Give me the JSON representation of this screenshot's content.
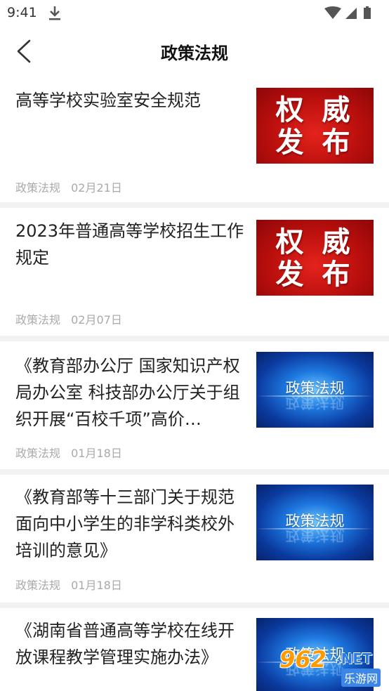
{
  "status_bar": {
    "time": "9:41"
  },
  "header": {
    "title": "政策法规"
  },
  "articles": [
    {
      "title": "高等学校实验室安全规范",
      "category": "政策法规",
      "date": "02月21日",
      "thumb_style": "red",
      "thumb_line1": "权 威",
      "thumb_line2": "发 布"
    },
    {
      "title": "2023年普通高等学校招生工作规定",
      "category": "政策法规",
      "date": "02月07日",
      "thumb_style": "red",
      "thumb_line1": "权 威",
      "thumb_line2": "发 布"
    },
    {
      "title": "《教育部办公厅 国家知识产权局办公室 科技部办公厅关于组织开展“百校千项”高价…",
      "category": "政策法规",
      "date": "01月18日",
      "thumb_style": "blue",
      "thumb_text": "政策法规"
    },
    {
      "title": "《教育部等十三部门关于规范面向中小学生的非学科类校外培训的意见》",
      "category": "政策法规",
      "date": "01月18日",
      "thumb_style": "blue",
      "thumb_text": "政策法规"
    },
    {
      "title": "《湖南省普通高等学校在线开放课程教学管理实施办法》",
      "category": "",
      "date": "",
      "thumb_style": "blue",
      "thumb_text": "政策法规"
    }
  ],
  "watermark": {
    "number": "962",
    "suffix": ".NET",
    "site": "乐游网"
  },
  "colors": {
    "accent_red": "#c8120f",
    "accent_blue": "#0b3a9f",
    "meta_gray": "#aaaaaa"
  }
}
